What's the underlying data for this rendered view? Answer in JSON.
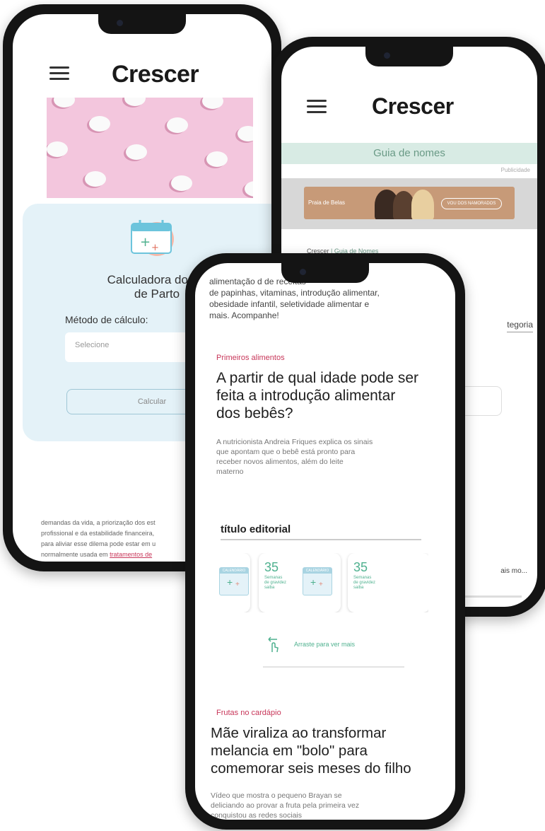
{
  "phone_back_left": {
    "logo": "Crescer",
    "calculator": {
      "title_line1": "Calculadora do Do",
      "title_line2": "de Parto",
      "method_label": "Método de cálculo:",
      "select_placeholder": "Selecione",
      "calculate_button": "Calcular"
    },
    "body_lines": [
      "demandas da vida, a priorização dos est",
      "profissional e da estabilidade financeira,",
      "para aliviar esse dilema pode estar em u",
      "normalmente usada em "
    ],
    "body_link": "tratamentos de"
  },
  "phone_back_right": {
    "logo": "Crescer",
    "section_bar": "Guia de nomes",
    "ad_label": "Publicidade",
    "ad": {
      "brand": "Praia de Belas",
      "cta": "VOU DOS NAMORADOS"
    },
    "breadcrumb_home": "Crescer",
    "breadcrumb_sep": " | ",
    "breadcrumb_current": "Guia de Nomes",
    "category_fragment": "tegoria",
    "trailing_text": "ais mo..."
  },
  "phone_front": {
    "intro_lines": [
      "alimentação d                    de receitas",
      "de papinhas, vitaminas, introdução alimentar,",
      "obesidade infantil, seletividade alimentar e",
      "mais. Acompanhe!"
    ],
    "article1": {
      "category": "Primeiros alimentos",
      "headline_lines": [
        "A partir de qual idade pode ser",
        "feita a introdução alimentar",
        "dos bebês?"
      ],
      "summary_lines": [
        "A nutricionista Andreia Friques explica os sinais",
        "que apontam que o bebê está pronto para",
        "receber novos alimentos, além do leite",
        "materno"
      ]
    },
    "editorial": {
      "title": "título editorial",
      "card_number": "35",
      "card_caption_lines": [
        "Semanas",
        "de gravidez",
        "saiba"
      ],
      "calendar_label": "CALENDÁRIO",
      "more_label": "Arraste para ver mais"
    },
    "article2": {
      "category": "Frutas no cardápio",
      "headline_lines": [
        "Mãe viraliza ao transformar",
        "melancia em \"bolo\" para",
        "comemorar seis meses do filho"
      ],
      "summary_lines": [
        "Vídeo que mostra o pequeno Brayan se",
        "deliciando ao provar a fruta pela primeira vez",
        "conquistou as redes sociais"
      ]
    }
  },
  "colors": {
    "accent_red": "#c8375a",
    "accent_green": "#4fb18f",
    "calculator_bg": "#e4f2f8",
    "section_bar_bg": "#d8ebe4",
    "hero_pink": "#f3c6dd",
    "phone_frame": "#141414"
  }
}
